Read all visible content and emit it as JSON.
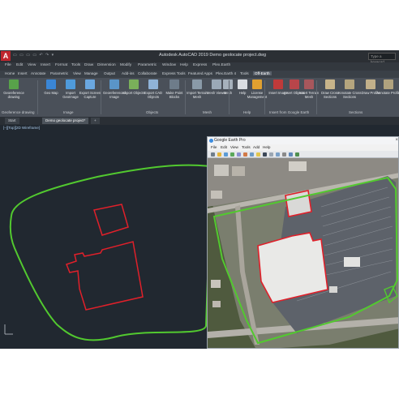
{
  "app": {
    "logo": "A",
    "title": "Autodesk AutoCAD 2019   Demo geolocate project.dwg",
    "quick_access": "▭ ▭ ▭ ▭ ↶ ↷ ▾",
    "search_placeholder": "Type a keyword"
  },
  "menu": [
    "File",
    "Edit",
    "View",
    "Insert",
    "Format",
    "Tools",
    "Draw",
    "Dimension",
    "Modify",
    "Parametric",
    "Window",
    "Help",
    "Express",
    "Plex.Earth"
  ],
  "ribbon_tabs": [
    {
      "label": "Home",
      "active": false
    },
    {
      "label": "Insert",
      "active": false
    },
    {
      "label": "Annotate",
      "active": false
    },
    {
      "label": "Parametric",
      "active": false
    },
    {
      "label": "View",
      "active": false
    },
    {
      "label": "Manage",
      "active": false
    },
    {
      "label": "Output",
      "active": false
    },
    {
      "label": "Add-ins",
      "active": false
    },
    {
      "label": "Collaborate",
      "active": false
    },
    {
      "label": "Express Tools",
      "active": false
    },
    {
      "label": "Featured Apps",
      "active": false
    },
    {
      "label": "Plex.Earth 4",
      "active": false
    },
    {
      "label": "Tools",
      "active": false
    },
    {
      "label": "Off-Earth",
      "active": true
    }
  ],
  "ribbon_buttons": [
    {
      "label": "Geo Map",
      "color": "#3a86d6",
      "icon": "geo-map-icon"
    },
    {
      "label": "Import GeoImage",
      "color": "#4f9bdc",
      "icon": "import-geoimage-icon"
    },
    {
      "label": "Export Screen Capture",
      "color": "#6aa7e0",
      "icon": "screen-capture-icon"
    },
    {
      "label": "Georeferenced Image",
      "color": "#5a95c8",
      "icon": "georef-image-icon"
    },
    {
      "label": "Import Objects",
      "color": "#7ab05a",
      "icon": "import-objects-icon"
    },
    {
      "label": "Export CAD Objects",
      "color": "#8fb3d8",
      "icon": "export-cad-icon"
    },
    {
      "label": "Make Point Blocks",
      "color": "#6e7c8a",
      "icon": "point-blocks-icon"
    },
    {
      "label": "Import Terrain Mesh",
      "color": "#8a9aa8",
      "icon": "terrain-mesh-icon"
    },
    {
      "label": "Mesh Viewer",
      "color": "#9aa8b6",
      "icon": "mesh-viewer-icon"
    },
    {
      "label": "Mesh",
      "color": "#a6b1bc",
      "icon": "mesh-icon"
    },
    {
      "label": "Help",
      "color": "#d9dde2",
      "icon": "help-icon"
    },
    {
      "label": "License Management",
      "color": "#e0a030",
      "icon": "license-icon"
    },
    {
      "label": "Insert Image",
      "color": "#c03a3a",
      "icon": "insert-image-icon"
    },
    {
      "label": "Insert Objects",
      "color": "#b8454a",
      "icon": "insert-objects-icon"
    },
    {
      "label": "Insert Terrain Mesh",
      "color": "#a8575c",
      "icon": "insert-terrain-icon"
    },
    {
      "label": "Draw Cross Sections",
      "color": "#c8b48a",
      "icon": "cross-sections-icon"
    },
    {
      "label": "Annotate Cross Sections",
      "color": "#b5a57e",
      "icon": "annotate-sections-icon"
    },
    {
      "label": "Draw Profile",
      "color": "#c2b08a",
      "icon": "draw-profile-icon"
    },
    {
      "label": "Annotate Profile",
      "color": "#b0a27e",
      "icon": "annotate-profile-icon"
    }
  ],
  "ribbon_panels": [
    {
      "label": "Geoference drawing"
    },
    {
      "label": "Image"
    },
    {
      "label": "Objects"
    },
    {
      "label": "Mesh"
    },
    {
      "label": "Help"
    },
    {
      "label": "Insert from Google Earth"
    },
    {
      "label": "Sections"
    }
  ],
  "ribbon_first": {
    "label": "Georeference drawing"
  },
  "doc_tabs": [
    {
      "label": "Start",
      "active": false
    },
    {
      "label": "Demo geolocate project*",
      "active": true
    },
    {
      "label": "+",
      "active": false
    }
  ],
  "viewport_label": "[–][Top][2D Wireframe]",
  "colors": {
    "boundary": "#52c92f",
    "building": "#e0202a",
    "canvas": "#212830"
  },
  "google_earth": {
    "title": "Google Earth Pro",
    "menu": [
      "File",
      "Edit",
      "View",
      "Tools",
      "Add",
      "Help"
    ]
  }
}
